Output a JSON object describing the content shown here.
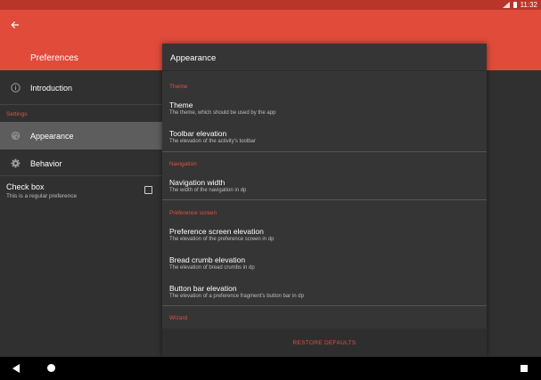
{
  "status": {
    "time": "11:32"
  },
  "colors": {
    "accent": "#e04b3a",
    "status_bar": "#b8352a",
    "category": "#e0533f",
    "background": "#303030"
  },
  "appbar": {
    "title": "Preferences",
    "back_icon": "arrow-left-icon"
  },
  "sidebar": {
    "introduction": "Introduction",
    "settings_category": "Settings",
    "appearance": "Appearance",
    "behavior": "Behavior",
    "checkbox": {
      "title": "Check box",
      "summary": "This is a regular preference",
      "checked": false
    }
  },
  "panel": {
    "title": "Appearance",
    "theme_category": "Theme",
    "theme": {
      "title": "Theme",
      "summary": "The theme, which should be used by the app"
    },
    "toolbar_elevation": {
      "title": "Toolbar elevation",
      "summary": "The elevation of the activity's toolbar"
    },
    "navigation_category": "Navigation",
    "navigation_width": {
      "title": "Navigation width",
      "summary": "The width of the navigation in dp"
    },
    "preference_screen_category": "Preference screen",
    "preference_screen_elevation": {
      "title": "Preference screen elevation",
      "summary": "The elevation of the preference screen in dp"
    },
    "bread_crumb_elevation": {
      "title": "Bread crumb elevation",
      "summary": "The elevation of bread crumbs in dp"
    },
    "button_bar_elevation": {
      "title": "Button bar elevation",
      "summary": "The elevation of a preference fragment's button bar in dp"
    },
    "wizard_category": "Wizard",
    "restore_defaults": "RESTORE DEFAULTS"
  }
}
